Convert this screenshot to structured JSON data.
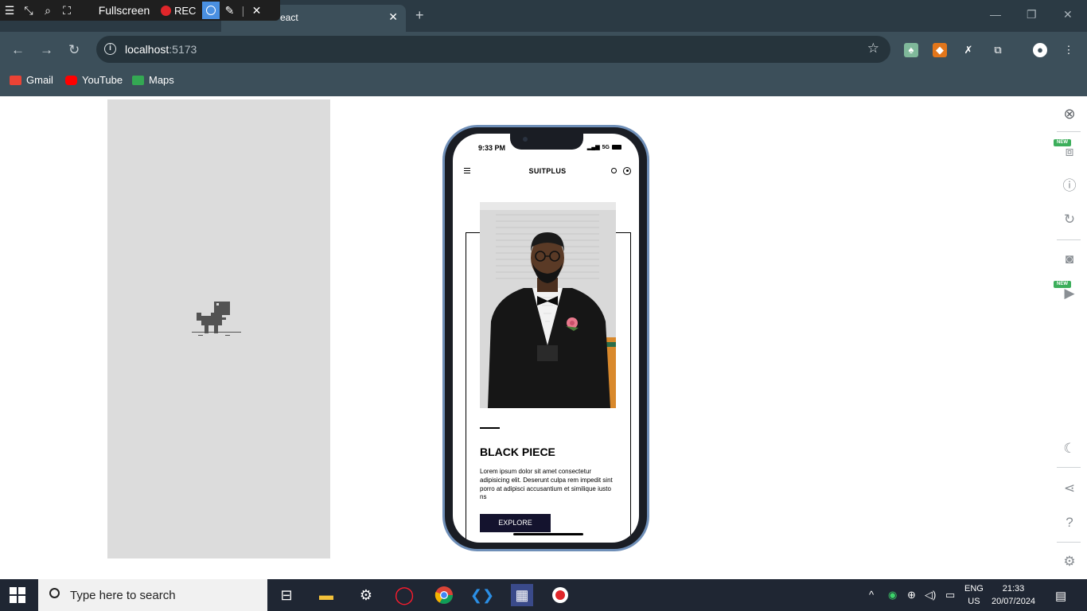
{
  "recorder": {
    "fullscreen_label": "Fullscreen",
    "rec_label": "REC"
  },
  "browser": {
    "tab_title": "eact",
    "url_host": "localhost",
    "url_port": ":5173",
    "bookmarks": [
      {
        "label": "Gmail",
        "color": "#ea4335"
      },
      {
        "label": "YouTube",
        "color": "#ff0000"
      },
      {
        "label": "Maps",
        "color": "#34a853"
      }
    ]
  },
  "phone": {
    "status_time": "9:33 PM",
    "status_network": "5G",
    "brand": "SUITPLUS",
    "product_title": "BLACK PIECE",
    "product_desc": "Lorem ipsum dolor sit amet consectetur adipisicing elit. Deserunt culpa rem impedit sint porro at adipisci accusantium et similique iusto ns",
    "explore_label": "EXPLORE"
  },
  "side_panel": {
    "new_badge": "NEW"
  },
  "taskbar": {
    "search_placeholder": "Type here to search",
    "lang_top": "ENG",
    "lang_bottom": "US",
    "time": "21:33",
    "date": "20/07/2024"
  }
}
